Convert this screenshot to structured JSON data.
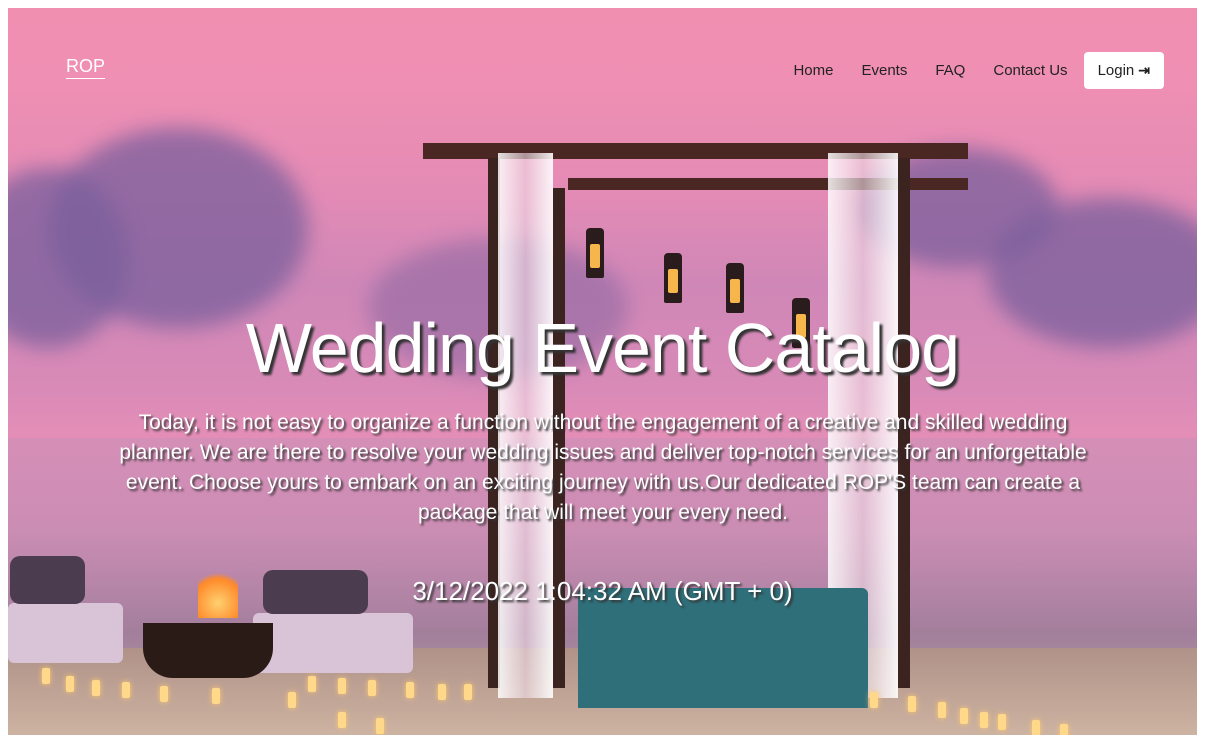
{
  "nav": {
    "brand": "ROP",
    "links": [
      "Home",
      "Events",
      "FAQ",
      "Contact Us"
    ],
    "login_label": "Login",
    "login_icon": "sign-in-icon"
  },
  "hero": {
    "title": "Wedding Event Catalog",
    "description": "Today, it is not easy to organize a function without the engagement of a creative and skilled wedding planner. We are there to resolve your wedding issues and deliver top-notch services for an unforgettable event. Choose yours to embark on an exciting journey with us.Our dedicated ROP'S team can create a package that will meet your every need.",
    "datetime": "3/12/2022 1:04:32 AM (GMT + 0)"
  }
}
